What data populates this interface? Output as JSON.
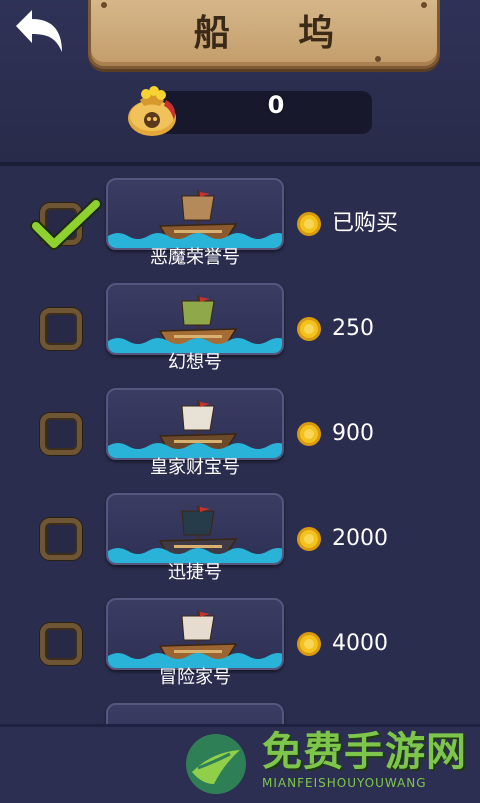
{
  "header": {
    "title": "船 坞",
    "coins": "0"
  },
  "ships": [
    {
      "name": "恶魔荣誉号",
      "price": "已购买",
      "checked": true,
      "sail": "#b58a5a",
      "hull": "#8a5a2e"
    },
    {
      "name": "幻想号",
      "price": "250",
      "checked": false,
      "sail": "#8ea84a",
      "hull": "#a56d35"
    },
    {
      "name": "皇家财宝号",
      "price": "900",
      "checked": false,
      "sail": "#e8e2d6",
      "hull": "#6a4a2a"
    },
    {
      "name": "迅捷号",
      "price": "2000",
      "checked": false,
      "sail": "#263c4a",
      "hull": "#3f3a45"
    },
    {
      "name": "冒险家号",
      "price": "4000",
      "checked": false,
      "sail": "#e6ddd0",
      "hull": "#9a6533"
    }
  ],
  "watermark": {
    "title": "免费手游网",
    "subtitle": "MIANFEISHOUYOUWANG"
  },
  "colors": {
    "background": "#2b2d4e",
    "wave": "#29b3d8",
    "coin": "#f3c21c",
    "check": "#8fd12e"
  }
}
